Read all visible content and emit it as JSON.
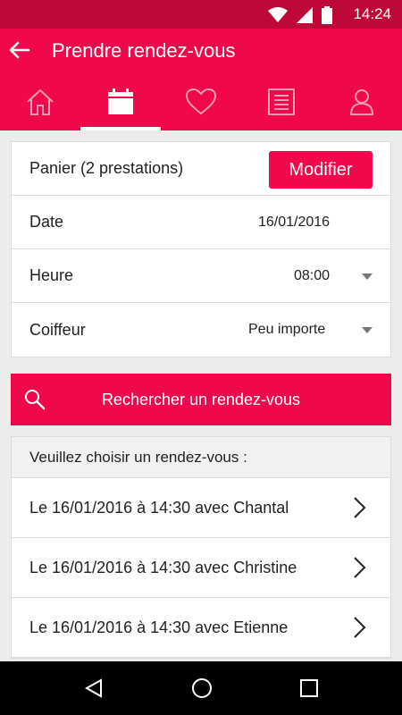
{
  "status": {
    "time": "14:24"
  },
  "appbar": {
    "title": "Prendre rendez-vous"
  },
  "tabs": [
    {
      "icon": "home-icon",
      "active": false
    },
    {
      "icon": "calendar-icon",
      "active": true
    },
    {
      "icon": "heart-icon",
      "active": false
    },
    {
      "icon": "list-icon",
      "active": false
    },
    {
      "icon": "profile-icon",
      "active": false
    }
  ],
  "form": {
    "cart_label": "Panier (2 prestations)",
    "modify_label": "Modifier",
    "date_label": "Date",
    "date_value": "16/01/2016",
    "time_label": "Heure",
    "time_value": "08:00",
    "hairdresser_label": "Coiffeur",
    "hairdresser_value": "Peu importe"
  },
  "search": {
    "label": "Rechercher un rendez-vous"
  },
  "results": {
    "header": "Veuillez choisir un rendez-vous :",
    "items": [
      {
        "label": "Le 16/01/2016 à 14:30 avec Chantal"
      },
      {
        "label": "Le 16/01/2016 à 14:30 avec Christine"
      },
      {
        "label": "Le 16/01/2016 à 14:30 avec Etienne"
      }
    ]
  },
  "colors": {
    "primary": "#f0094a",
    "statusbar": "#bd0838"
  }
}
